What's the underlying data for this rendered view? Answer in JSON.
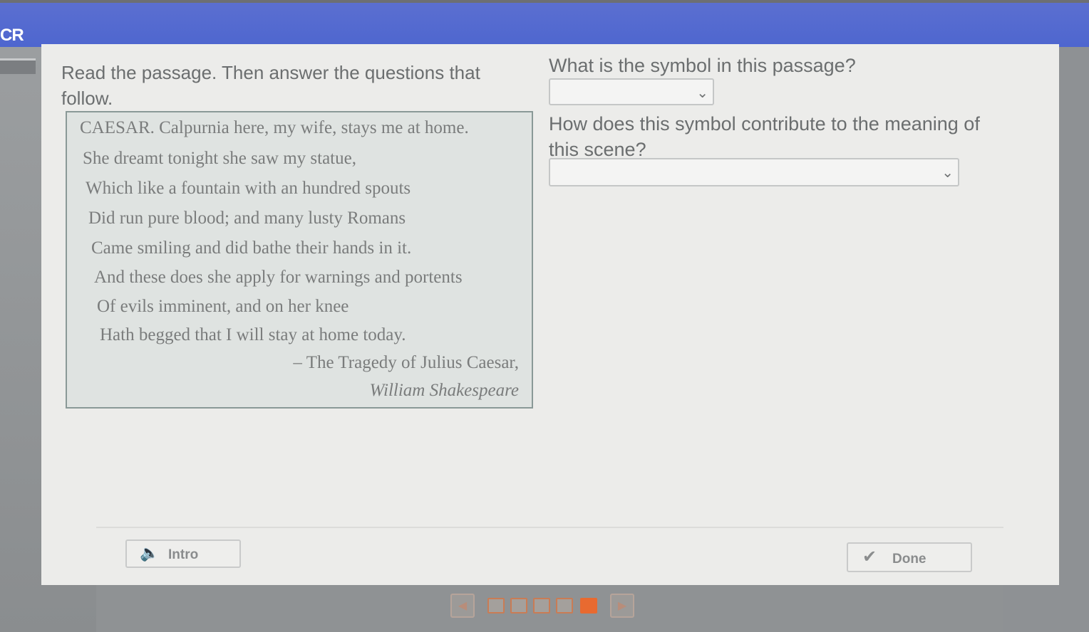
{
  "app": {
    "label": "CR",
    "colors": {
      "header": "#4e66cf",
      "accent": "#e86a30"
    }
  },
  "instructions": "Read the passage. Then answer the questions that follow.",
  "passage": {
    "lines": [
      "CAESAR. Calpurnia here, my wife, stays me at home.",
      "She dreamt tonight she saw my statue,",
      "Which like a fountain with an hundred spouts",
      "Did run pure blood; and many lusty Romans",
      "Came smiling and did bathe their hands in it.",
      "And these does she apply for warnings and portents",
      "Of evils imminent, and on her knee",
      "Hath begged that I will stay at home today."
    ],
    "source": "– The Tragedy of Julius Caesar,",
    "author": "William Shakespeare"
  },
  "questions": [
    {
      "prompt": "What is the symbol in this passage?",
      "selected": ""
    },
    {
      "prompt": "How does this symbol contribute to the meaning of this scene?",
      "selected": ""
    }
  ],
  "footer": {
    "intro_label": "Intro",
    "done_label": "Done",
    "intro_icon": "speaker-icon",
    "done_icon": "checkmark-icon"
  },
  "pagination": {
    "total_boxes": 5,
    "current": 5,
    "prev_icon": "chevron-left-icon",
    "next_icon": "chevron-right-icon"
  }
}
